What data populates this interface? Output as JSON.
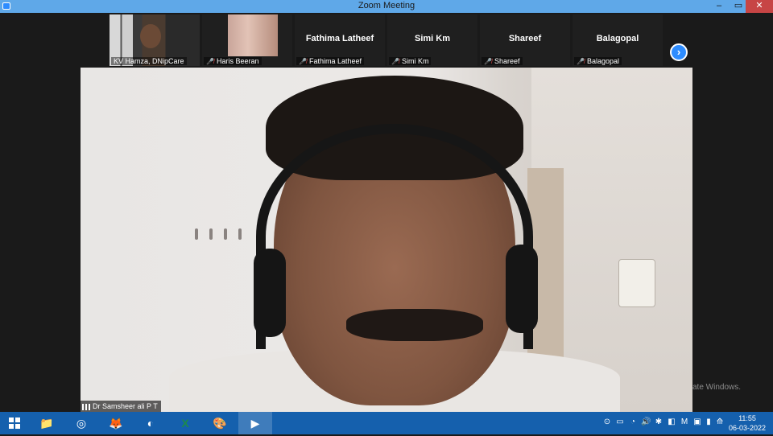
{
  "window": {
    "title": "Zoom Meeting",
    "min": "–",
    "restore": "▭",
    "close": "✕"
  },
  "participants_strip": {
    "tiles": [
      {
        "label": "KV Hamza, DNipCare",
        "big_name": "",
        "muted": false,
        "has_video": true
      },
      {
        "label": "Haris Beeran",
        "big_name": "",
        "muted": true,
        "has_video": true
      },
      {
        "label": "Fathima Latheef",
        "big_name": "Fathima Latheef",
        "muted": true,
        "has_video": false
      },
      {
        "label": "Simi Km",
        "big_name": "Simi Km",
        "muted": true,
        "has_video": false
      },
      {
        "label": "Shareef",
        "big_name": "Shareef",
        "muted": true,
        "has_video": false
      },
      {
        "label": "Balagopal",
        "big_name": "Balagopal",
        "muted": true,
        "has_video": false
      }
    ],
    "next_icon": "›"
  },
  "speaker": {
    "name": "Dr Samsheer ali P T"
  },
  "watermark": {
    "text": "ate Windows."
  },
  "taskbar": {
    "apps": [
      {
        "name": "file-explorer-icon",
        "glyph": "📁"
      },
      {
        "name": "antivirus-icon",
        "glyph": "◎"
      },
      {
        "name": "firefox-icon",
        "glyph": "🦊"
      },
      {
        "name": "edge-icon",
        "glyph": "◐"
      },
      {
        "name": "excel-icon",
        "glyph": "X"
      },
      {
        "name": "paint-icon",
        "glyph": "🎨"
      },
      {
        "name": "zoom-icon",
        "glyph": "▶"
      }
    ],
    "tray_icons": [
      "⊙",
      "▭",
      "◔",
      "🔊",
      "✱",
      "◧",
      "M",
      "▣",
      "▮",
      "⟰"
    ],
    "clock": {
      "time": "11:55",
      "date": "06-03-2022"
    }
  },
  "colors": {
    "titlebar": "#5fa8e8",
    "taskbar": "#1560ad",
    "accent": "#2d8cff",
    "mute": "#e04848"
  }
}
